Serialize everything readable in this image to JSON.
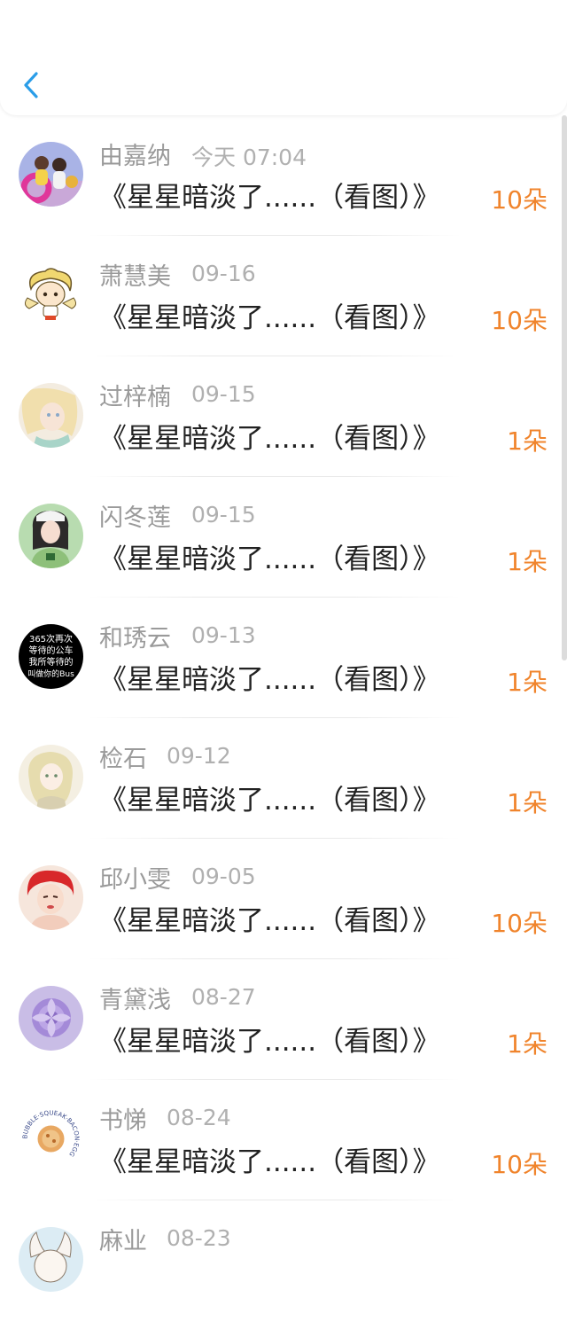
{
  "header": {
    "back_icon": "chevron-left-icon",
    "accent": "#2a9de8"
  },
  "colors": {
    "count": "#f0842c",
    "name": "#9a9a9a",
    "date": "#b0b0b0",
    "title": "#222222"
  },
  "items": [
    {
      "name": "由嘉纳",
      "date": "今天 07:04",
      "title": "《星星暗淡了......（看图）》",
      "count": "10朵"
    },
    {
      "name": "萧慧美",
      "date": "09-16",
      "title": "《星星暗淡了......（看图）》",
      "count": "10朵"
    },
    {
      "name": "过梓楠",
      "date": "09-15",
      "title": "《星星暗淡了......（看图）》",
      "count": "1朵"
    },
    {
      "name": "闪冬莲",
      "date": "09-15",
      "title": "《星星暗淡了......（看图）》",
      "count": "1朵"
    },
    {
      "name": "和琇云",
      "date": "09-13",
      "title": "《星星暗淡了......（看图）》",
      "count": "1朵",
      "avatar_text": [
        "365次再次",
        "等待的公车",
        "我所等待的",
        "叫做你的Bus"
      ]
    },
    {
      "name": "检石",
      "date": "09-12",
      "title": "《星星暗淡了......（看图）》",
      "count": "1朵"
    },
    {
      "name": "邱小雯",
      "date": "09-05",
      "title": "《星星暗淡了......（看图）》",
      "count": "10朵"
    },
    {
      "name": "青黛浅",
      "date": "08-27",
      "title": "《星星暗淡了......（看图）》",
      "count": "1朵"
    },
    {
      "name": "书悌",
      "date": "08-24",
      "title": "《星星暗淡了......（看图）》",
      "count": "10朵",
      "avatar_text": [
        "BUBBLE·SQUEAK·BACON·EGG"
      ]
    },
    {
      "name": "麻业",
      "date": "08-23",
      "title": "",
      "count": ""
    }
  ]
}
